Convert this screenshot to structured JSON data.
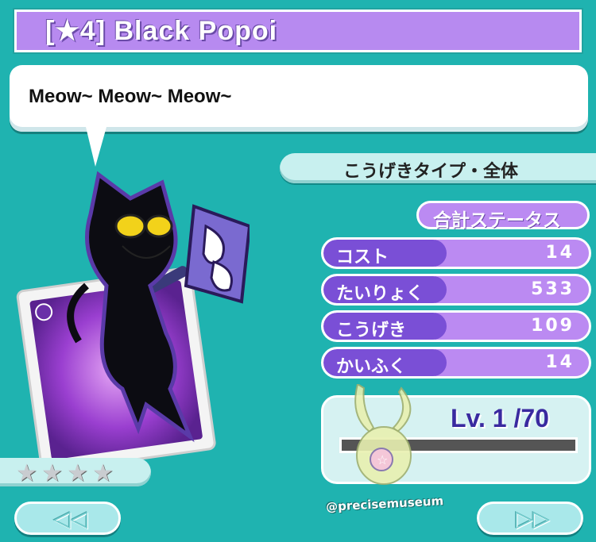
{
  "header": {
    "title": "[★4] Black Popoi"
  },
  "dialog": {
    "text": "Meow~ Meow~ Meow~"
  },
  "card": {
    "type_label": "こうげきタイプ・全体"
  },
  "status": {
    "header_label": "合計ステータス",
    "rows": [
      {
        "label": "コスト",
        "value": "14"
      },
      {
        "label": "たいりょく",
        "value": "533"
      },
      {
        "label": "こうげき",
        "value": "109"
      },
      {
        "label": "かいふく",
        "value": "14"
      }
    ]
  },
  "level": {
    "text": "Lv. 1 /70",
    "exp_fraction": 0
  },
  "rarity": {
    "stars": [
      "★",
      "★",
      "★",
      "★"
    ]
  },
  "nav": {
    "prev_label": "◁◁",
    "next_label": "▷▷"
  },
  "watermark": "@precisemuseum",
  "colors": {
    "background": "#1fb3b0",
    "title_bar": "#b78af0",
    "stat_label": "#7a4fd6",
    "stat_fill": "#bb8af2"
  }
}
